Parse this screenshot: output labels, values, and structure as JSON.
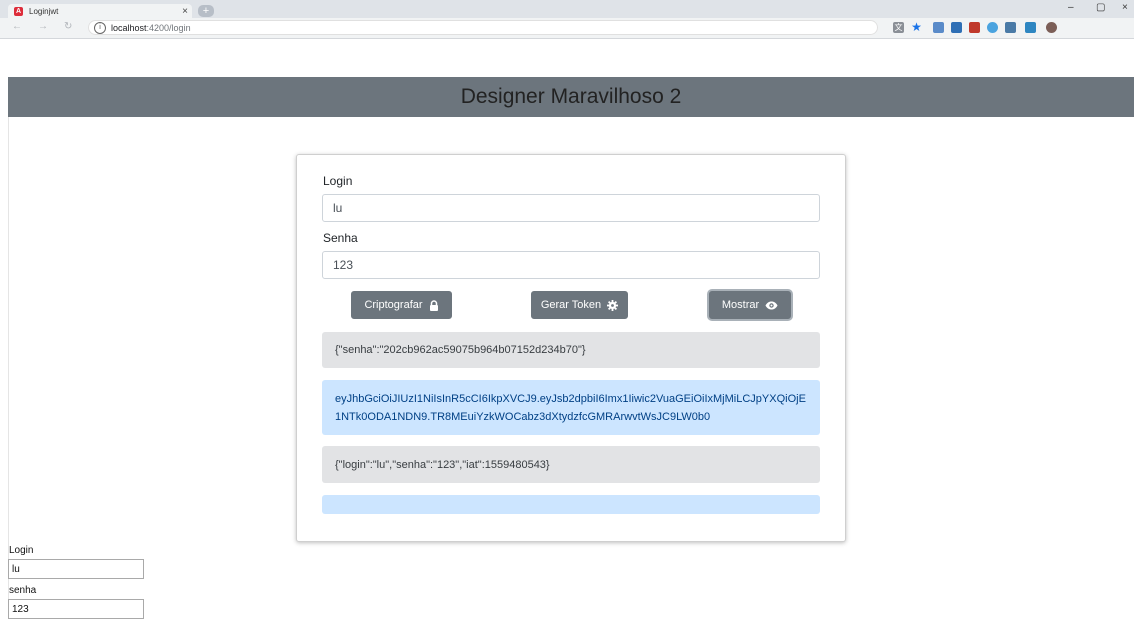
{
  "browser": {
    "tab_title": "Loginjwt",
    "tab_close": "×",
    "new_tab": "+",
    "url_host": "localhost",
    "url_path": ":4200/login",
    "win_min": "–",
    "win_max": "▢",
    "win_close": "×"
  },
  "header": {
    "title": "Designer Maravilhoso 2"
  },
  "form": {
    "login_label": "Login",
    "login_value": "lu",
    "senha_label": "Senha",
    "senha_value": "123"
  },
  "buttons": {
    "encrypt": "Criptografar",
    "token": "Gerar Token",
    "show": "Mostrar"
  },
  "results": {
    "hash": "{\"senha\":\"202cb962ac59075b964b07152d234b70\"}",
    "token": "eyJhbGciOiJIUzI1NiIsInR5cCI6IkpXVCJ9.eyJsb2dpbiI6Imx1Iiwic2VuaGEiOiIxMjMiLCJpYXQiOjE1NTk0ODA1NDN9.TR8MEuiYzkWOCabz3dXtydzfcGMRArwvtWsJC9LW0b0",
    "decoded": "{\"login\":\"lu\",\"senha\":\"123\",\"iat\":1559480543}",
    "empty": ""
  },
  "bottom_form": {
    "login_label": "Login",
    "login_value": "lu",
    "senha_label": "senha",
    "senha_value": "123"
  },
  "icons": {
    "encrypt": "lock-icon",
    "token": "gear-icon",
    "show": "eye-icon"
  },
  "colors": {
    "header_bg": "#6c757d",
    "button_bg": "#6c757d",
    "alert_grey": "#e2e3e5",
    "alert_blue": "#cce5ff"
  }
}
